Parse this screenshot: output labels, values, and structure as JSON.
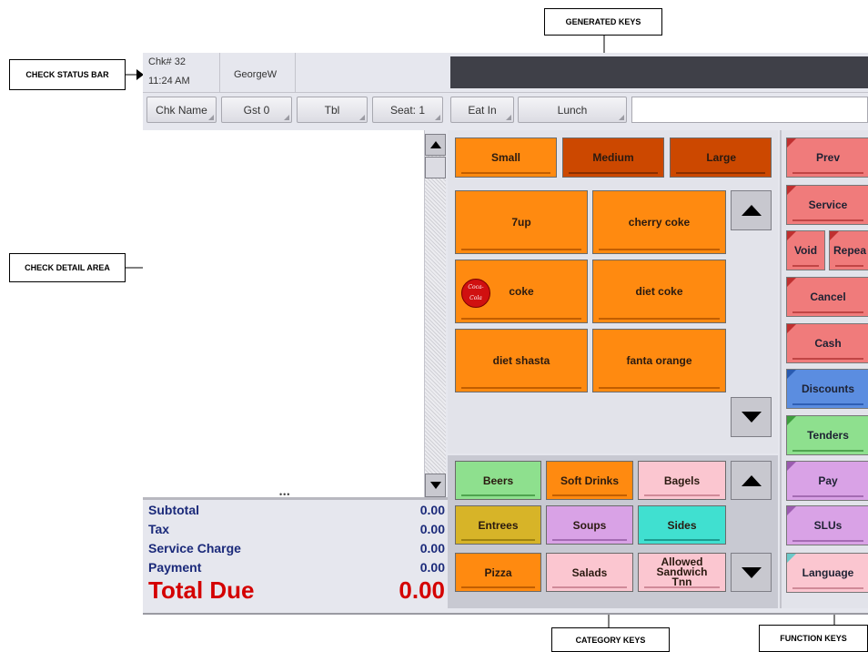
{
  "callouts": {
    "generated_keys": "GENERATED  KEYS",
    "check_status_bar": "CHECK STATUS BAR",
    "check_detail_area": "CHECK DETAIL AREA",
    "category_keys": "CATEGORY KEYS",
    "function_keys": "FUNCTION  KEYS"
  },
  "status": {
    "check_number": "Chk# 32",
    "time": "11:24 AM",
    "employee": "GeorgeW"
  },
  "toolbar": {
    "chk_name": "Chk Name",
    "guests": "Gst 0",
    "table": "Tbl",
    "seat": "Seat: 1",
    "order_type": "Eat In",
    "meal_period": "Lunch"
  },
  "detail": {
    "grip": "•••"
  },
  "totals": {
    "subtotal_label": "Subtotal",
    "subtotal_value": "0.00",
    "tax_label": "Tax",
    "tax_value": "0.00",
    "service_label": "Service Charge",
    "service_value": "0.00",
    "payment_label": "Payment",
    "payment_value": "0.00",
    "total_label": "Total Due",
    "total_value": "0.00",
    "total_color": "#d40000"
  },
  "sizes": {
    "small": "Small",
    "medium": "Medium",
    "large": "Large"
  },
  "menu_items": {
    "item1": "7up",
    "item2": "cherry coke",
    "item3": "coke",
    "item4": "diet coke",
    "item5": "diet shasta",
    "item6": "fanta orange",
    "coke_logo": "Coca-Cola"
  },
  "categories": {
    "beers": "Beers",
    "soft_drinks": "Soft Drinks",
    "bagels": "Bagels",
    "entrees": "Entrees",
    "soups": "Soups",
    "sides": "Sides",
    "pizza": "Pizza",
    "salads": "Salads",
    "allowed_line1": "Allowed",
    "allowed_line2": "Sandwich",
    "allowed_line3": "Tnn"
  },
  "function_keys": {
    "prev": "Prev",
    "service": "Service",
    "void": "Void",
    "repeat": "Repea",
    "cancel": "Cancel",
    "cash": "Cash",
    "discounts": "Discounts",
    "tenders": "Tenders",
    "pay": "Pay",
    "slus": "SLUs",
    "language": "Language"
  },
  "colors": {
    "orange_key": "#ff8a10",
    "dark_orange_key": "#cc4800",
    "red_function": "#f07b7b",
    "blue_function": "#5b8de0",
    "green_function": "#8ee08e",
    "purple_function": "#d9a2e6"
  }
}
